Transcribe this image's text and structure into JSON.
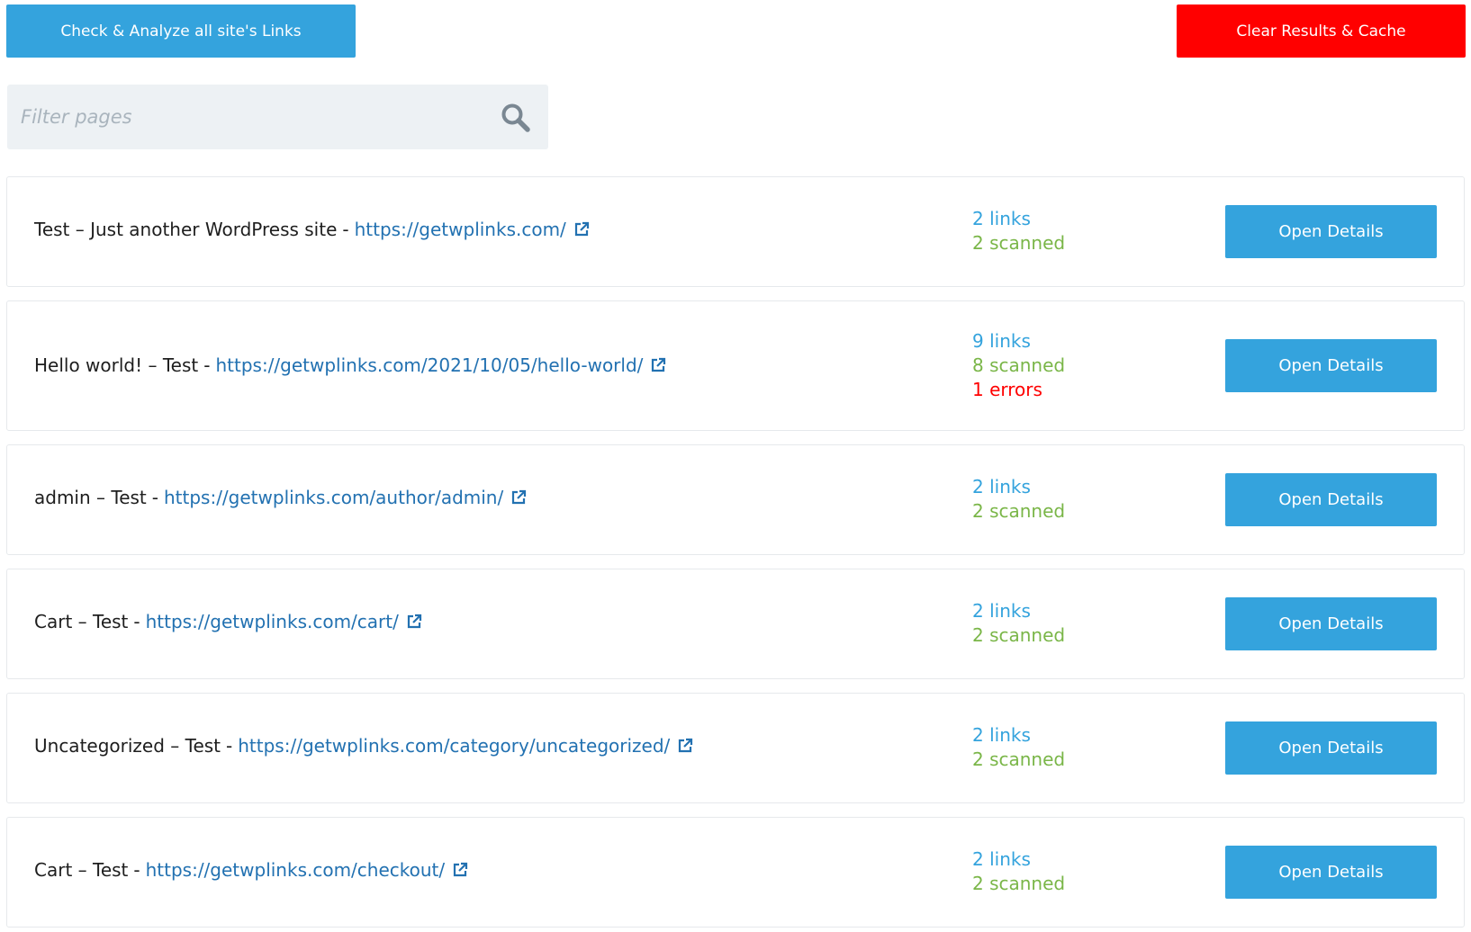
{
  "toolbar": {
    "analyze_label": "Check & Analyze all site's Links",
    "clear_label": "Clear Results & Cache"
  },
  "filter": {
    "placeholder": "Filter pages",
    "value": ""
  },
  "colors": {
    "primary": "#34a3dd",
    "danger": "#ff0000",
    "link": "#2271b1",
    "scanned": "#7ab648",
    "filter_bg": "#edf1f4"
  },
  "rows": [
    {
      "title": "Test – Just another WordPress site",
      "sep": "-",
      "url": "https://getwplinks.com/",
      "links": "2 links",
      "scanned": "2 scanned",
      "errors": "",
      "button": "Open Details"
    },
    {
      "title": "Hello world! – Test",
      "sep": "-",
      "url": "https://getwplinks.com/2021/10/05/hello-world/",
      "links": "9 links",
      "scanned": "8 scanned",
      "errors": "1 errors",
      "button": "Open Details"
    },
    {
      "title": "admin – Test",
      "sep": "-",
      "url": "https://getwplinks.com/author/admin/",
      "links": "2 links",
      "scanned": "2 scanned",
      "errors": "",
      "button": "Open Details"
    },
    {
      "title": "Cart – Test",
      "sep": "-",
      "url": "https://getwplinks.com/cart/",
      "links": "2 links",
      "scanned": "2 scanned",
      "errors": "",
      "button": "Open Details"
    },
    {
      "title": "Uncategorized – Test",
      "sep": "-",
      "url": "https://getwplinks.com/category/uncategorized/",
      "links": "2 links",
      "scanned": "2 scanned",
      "errors": "",
      "button": "Open Details"
    },
    {
      "title": "Cart – Test",
      "sep": "-",
      "url": "https://getwplinks.com/checkout/",
      "links": "2 links",
      "scanned": "2 scanned",
      "errors": "",
      "button": "Open Details"
    }
  ]
}
